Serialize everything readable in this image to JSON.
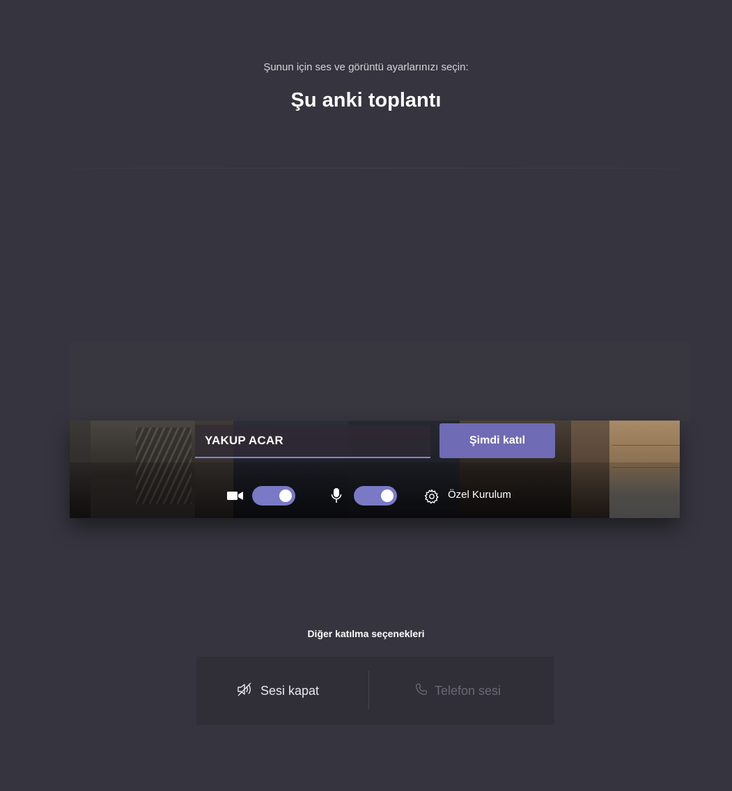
{
  "header": {
    "subtitle": "Şunun için ses ve görüntü ayarlarınızı seçin:",
    "title": "Şu anki toplantı"
  },
  "join": {
    "name_value": "YAKUP ACAR",
    "join_button_label": "Şimdi katıl"
  },
  "controls": {
    "camera_icon": "video-camera-icon",
    "camera_on": true,
    "mic_icon": "microphone-icon",
    "mic_on": true,
    "settings_icon": "gear-icon",
    "settings_label": "Özel Kurulum"
  },
  "other_options": {
    "title": "Diğer katılma seçenekleri",
    "mute_icon": "speaker-muted-icon",
    "mute_label": "Sesi kapat",
    "phone_icon": "phone-icon",
    "phone_label": "Telefon sesi"
  },
  "colors": {
    "background": "#36353f",
    "accent": "#6f6bb4",
    "toggle_on": "#7a79c6"
  }
}
